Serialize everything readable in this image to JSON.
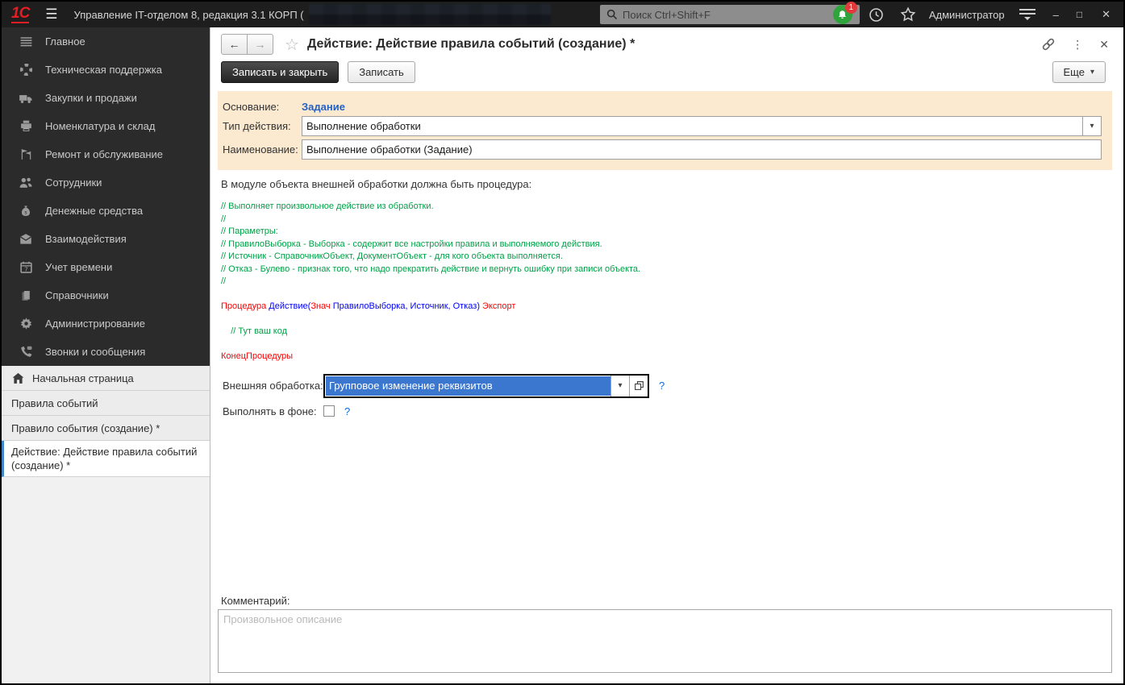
{
  "icons": {
    "hamburger": "☰",
    "caret_down": "▾",
    "close": "✕",
    "back_arrow": "←",
    "forward_arrow": "→",
    "star": "☆",
    "dots": "⋮",
    "minimize": "–",
    "maximize": "□",
    "help": "?"
  },
  "colors": {
    "topbar_bg": "#1e1e1e",
    "sidebar_bg": "#2b2b2b",
    "form_bg": "#fbeacf",
    "link_blue": "#2461c4",
    "code_green": "#00a147",
    "code_red": "#fb0000",
    "code_blue": "#0000fb",
    "selection_blue": "#3c77cf",
    "tab_accent": "#3f87c9",
    "bell_green": "#2fa43c",
    "badge_red": "#e03a3a",
    "logo_red": "#e31e24"
  },
  "titlebar": {
    "logo": "1С",
    "app_title": "Управление IT-отделом 8, редакция 3.1 КОРП (",
    "search_placeholder": "Поиск Ctrl+Shift+F",
    "notification_badge": "1",
    "user": "Администратор"
  },
  "sidebar": {
    "items": [
      {
        "key": "main",
        "icon": "main-menu-icon",
        "label": "Главное"
      },
      {
        "key": "support",
        "icon": "support-icon",
        "label": "Техническая поддержка"
      },
      {
        "key": "sales",
        "icon": "truck-icon",
        "label": "Закупки и продажи"
      },
      {
        "key": "stock",
        "icon": "printer-icon",
        "label": "Номенклатура и склад"
      },
      {
        "key": "repair",
        "icon": "flags-icon",
        "label": "Ремонт и обслуживание"
      },
      {
        "key": "employees",
        "icon": "people-icon",
        "label": "Сотрудники"
      },
      {
        "key": "money",
        "icon": "money-bag-icon",
        "label": "Денежные средства"
      },
      {
        "key": "interactions",
        "icon": "envelope-icon",
        "label": "Взаимодействия"
      },
      {
        "key": "time",
        "icon": "calendar-icon",
        "label": "Учет времени"
      },
      {
        "key": "catalogs",
        "icon": "books-icon",
        "label": "Справочники"
      },
      {
        "key": "admin",
        "icon": "gear-icon",
        "label": "Администрирование"
      },
      {
        "key": "calls",
        "icon": "phone-icon",
        "label": "Звонки и сообщения"
      }
    ]
  },
  "tabs": [
    {
      "key": "home",
      "icon": "home-icon",
      "label": "Начальная страница",
      "active": false
    },
    {
      "key": "event-rules",
      "icon": "",
      "label": "Правила событий",
      "active": false
    },
    {
      "key": "event-rule-create",
      "icon": "",
      "label": "Правило события (создание) *",
      "active": false
    },
    {
      "key": "action-create",
      "icon": "",
      "label": "Действие: Действие правила событий (создание) *",
      "active": true
    }
  ],
  "doc": {
    "title": "Действие: Действие правила событий (создание) *",
    "save_close_label": "Записать и закрыть",
    "save_label": "Записать",
    "more_label": "Еще"
  },
  "form": {
    "osnovanie_label": "Основание:",
    "osnovanie_value": "Задание",
    "type_label": "Тип действия:",
    "type_value": "Выполнение обработки",
    "name_label": "Наименование:",
    "name_value": "Выполнение обработки (Задание)",
    "hint": "В модуле объекта внешней обработки должна быть процедура:",
    "code_lines": [
      {
        "seg": [
          {
            "t": "// Выполняет произвольное действие из обработки.",
            "c": "g"
          }
        ]
      },
      {
        "seg": [
          {
            "t": "//",
            "c": "g"
          }
        ]
      },
      {
        "seg": [
          {
            "t": "// Параметры:",
            "c": "g"
          }
        ]
      },
      {
        "seg": [
          {
            "t": "// ПравилоВыборка - Выборка - содержит все настройки правила и выполняемого действия.",
            "c": "g"
          }
        ]
      },
      {
        "seg": [
          {
            "t": "// Источник - СправочникОбъект, ДокументОбъект - для кого объекта выполняется.",
            "c": "g"
          }
        ]
      },
      {
        "seg": [
          {
            "t": "// Отказ - Булево - признак того, что надо прекратить действие и вернуть ошибку при записи объекта.",
            "c": "g"
          }
        ]
      },
      {
        "seg": [
          {
            "t": "//",
            "c": "g"
          }
        ]
      },
      {
        "seg": []
      },
      {
        "seg": [
          {
            "t": "Процедура ",
            "c": "r"
          },
          {
            "t": "Действие(",
            "c": "b"
          },
          {
            "t": "Знач ",
            "c": "r"
          },
          {
            "t": "ПравилоВыборка, Источник, Отказ)",
            "c": "b"
          },
          {
            "t": " Экспорт",
            "c": "r"
          }
        ]
      },
      {
        "seg": []
      },
      {
        "seg": [
          {
            "t": "    // Тут ваш код",
            "c": "g"
          }
        ]
      },
      {
        "seg": []
      },
      {
        "seg": [
          {
            "t": "КонецПроцедуры",
            "c": "r"
          }
        ]
      }
    ],
    "external_label": "Внешняя обработка:",
    "external_value": "Групповое изменение реквизитов",
    "background_label": "Выполнять в фоне:",
    "comment_label": "Комментарий:",
    "comment_placeholder": "Произвольное описание"
  }
}
